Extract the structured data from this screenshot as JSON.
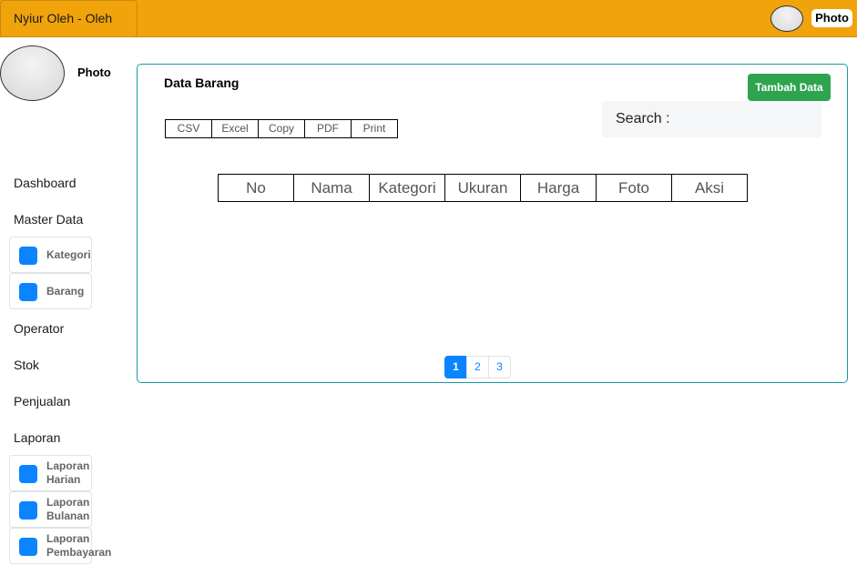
{
  "header": {
    "brand": "Nyiur Oleh - Oleh",
    "photo_label": "Photo"
  },
  "sidebar": {
    "photo_label": "Photo",
    "menu": {
      "dashboard": "Dashboard",
      "master_data": "Master Data",
      "master_items": [
        "Kategori",
        "Barang"
      ],
      "operator": "Operator",
      "stok": "Stok",
      "penjualan": "Penjualan",
      "laporan": "Laporan",
      "laporan_items": [
        [
          "Laporan",
          "Harian"
        ],
        [
          "Laporan",
          "Bulanan"
        ],
        [
          "Laporan",
          "Pembayaran"
        ]
      ]
    }
  },
  "main": {
    "title": "Data Barang",
    "add_button": "Tambah Data",
    "search_label": "Search :",
    "export_buttons": [
      "CSV",
      "Excel",
      "Copy",
      "PDF",
      "Print"
    ],
    "table_headers": [
      "No",
      "Nama",
      "Kategori",
      "Ukuran",
      "Harga",
      "Foto",
      "Aksi"
    ],
    "pagination": {
      "pages": [
        "1",
        "2",
        "3"
      ],
      "active": "1"
    }
  },
  "colors": {
    "header_bg": "#f0a30a",
    "panel_border": "#1a9ba1",
    "add_button_bg": "#2ea44f",
    "accent_blue": "#0a84ff"
  }
}
